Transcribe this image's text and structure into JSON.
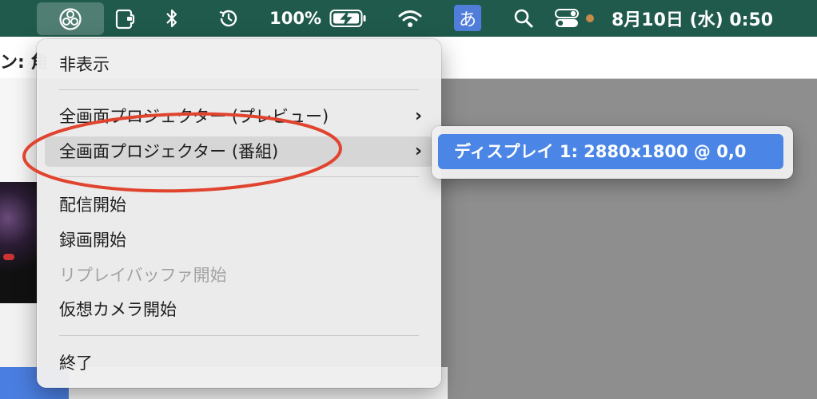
{
  "menubar": {
    "battery_percent": "100%",
    "ime_label": "あ",
    "clock": "8月10日 (水)  0:50",
    "accent_color": "#1f5a4c"
  },
  "background_window": {
    "title_fragment": "ン: 角"
  },
  "menu": {
    "items": [
      {
        "label": "非表示",
        "enabled": true
      },
      {
        "label": "全画面プロジェクター (プレビュー)",
        "enabled": true,
        "has_submenu": true
      },
      {
        "label": "全画面プロジェクター (番組)",
        "enabled": true,
        "has_submenu": true,
        "highlighted": true
      },
      {
        "label": "配信開始",
        "enabled": true
      },
      {
        "label": "録画開始",
        "enabled": true
      },
      {
        "label": "リプレイバッファ開始",
        "enabled": false
      },
      {
        "label": "仮想カメラ開始",
        "enabled": true
      },
      {
        "label": "終了",
        "enabled": true
      }
    ]
  },
  "submenu": {
    "items": [
      {
        "label": "ディスプレイ 1: 2880x1800 @ 0,0",
        "selected": true
      }
    ],
    "highlight_color": "#4b86e6"
  },
  "annotation": {
    "type": "ellipse",
    "color": "#e0442e"
  },
  "icons": [
    "obs-icon",
    "wallet-icon",
    "bluetooth-icon",
    "time-machine-icon",
    "battery-charging-icon",
    "wifi-icon",
    "search-icon",
    "control-center-icon",
    "chevron-right-icon"
  ]
}
